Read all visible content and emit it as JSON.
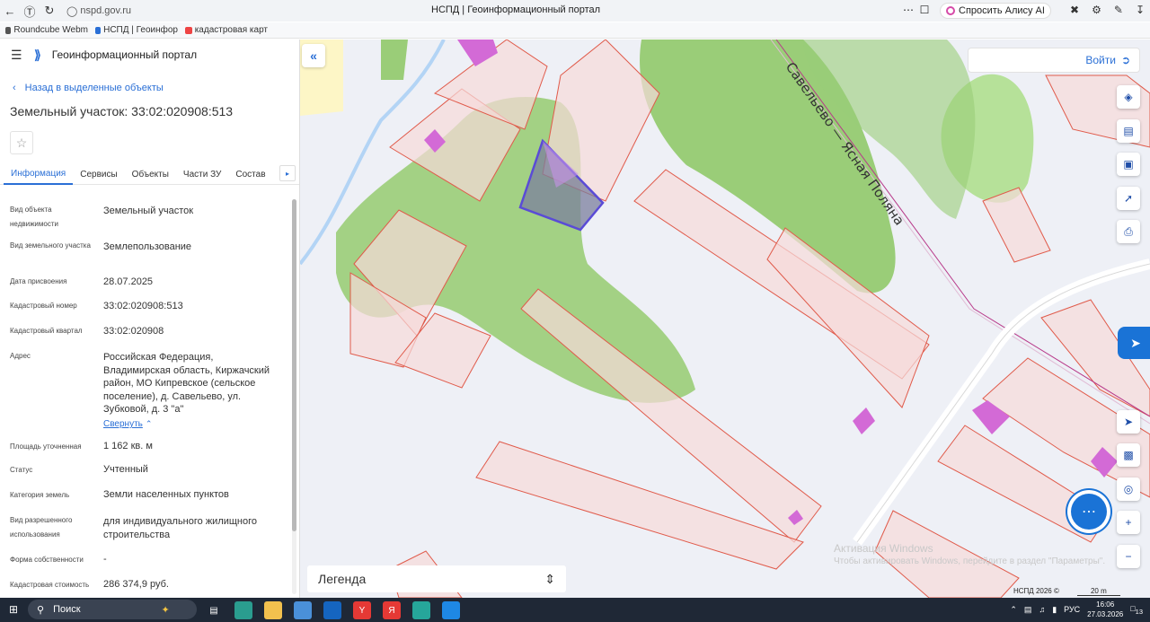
{
  "browser": {
    "url": "nspd.gov.ru",
    "tab_title": "НСПД | Геоинформационный портал",
    "alice_label": "Спросить Алису AI",
    "bookmarks": [
      "Roundcube Webm",
      "НСПД | Геоинфор",
      "кадастровая карт"
    ]
  },
  "panel": {
    "portal_name": "Геоинформационный портал",
    "back_label": "Назад в выделенные объекты",
    "object_title": "Земельный участок: 33:02:020908:513",
    "tabs": [
      "Информация",
      "Сервисы",
      "Объекты",
      "Части ЗУ",
      "Состав"
    ],
    "active_tab": "Информация",
    "fields": [
      {
        "label": "Вид объекта недвижимости",
        "value": "Земельный участок"
      },
      {
        "label": "Вид земельного участка",
        "value": "Землепользование"
      },
      {
        "label": "Дата присвоения",
        "value": "28.07.2025"
      },
      {
        "label": "Кадастровый номер",
        "value": "33:02:020908:513"
      },
      {
        "label": "Кадастровый квартал",
        "value": "33:02:020908"
      },
      {
        "label": "Адрес",
        "value": "Российская Федерация, Владимирская область, Киржачский район, МО Кипревское (сельское поселение), д. Савельево, ул. Зубковой, д. 3 \"а\""
      },
      {
        "label": "Площадь уточненная",
        "value": "1 162 кв. м"
      },
      {
        "label": "Статус",
        "value": "Учтенный"
      },
      {
        "label": "Категория земель",
        "value": "Земли населенных пунктов"
      },
      {
        "label": "Вид разрешенного использования",
        "value": "для индивидуального жилищного строительства"
      },
      {
        "label": "Форма собственности",
        "value": "-"
      },
      {
        "label": "Кадастровая стоимость",
        "value": "286 374,9 руб."
      }
    ],
    "collapse_label": "Свернуть"
  },
  "map": {
    "login_label": "Войти",
    "road_label": "Савельево — Ясная Поляна",
    "legend_label": "Легенда",
    "copyright": "НСПД 2026 ©",
    "scale_label": "20 m",
    "watermark_title": "Активация Windows",
    "watermark_text": "Чтобы активировать Windows, перейдите в раздел \"Параметры\"."
  },
  "taskbar": {
    "search_label": "Поиск",
    "lang": "РУС",
    "time": "16:06",
    "date": "27.03.2026",
    "notif_count": "13"
  },
  "colors": {
    "accent": "#2a6fd6",
    "parcel_fill": "#f7dada",
    "parcel_stroke": "#e05a4a",
    "vegetation": "#9acd78",
    "building": "#d36ad6",
    "selected": "#5a4bd6"
  }
}
